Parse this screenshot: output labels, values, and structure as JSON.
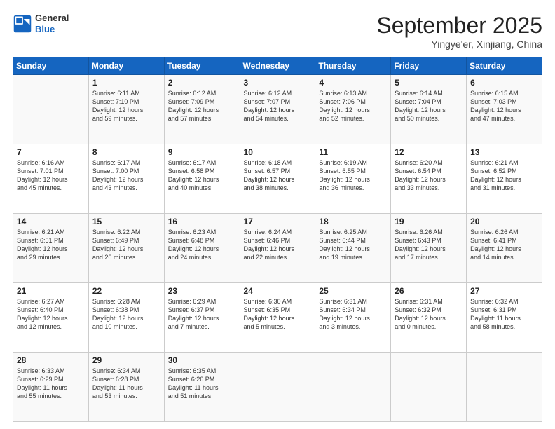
{
  "header": {
    "logo": {
      "general": "General",
      "blue": "Blue"
    },
    "title": "September 2025",
    "location": "Yingye'er, Xinjiang, China"
  },
  "days_of_week": [
    "Sunday",
    "Monday",
    "Tuesday",
    "Wednesday",
    "Thursday",
    "Friday",
    "Saturday"
  ],
  "weeks": [
    [
      {
        "day": "",
        "info": ""
      },
      {
        "day": "1",
        "info": "Sunrise: 6:11 AM\nSunset: 7:10 PM\nDaylight: 12 hours\nand 59 minutes."
      },
      {
        "day": "2",
        "info": "Sunrise: 6:12 AM\nSunset: 7:09 PM\nDaylight: 12 hours\nand 57 minutes."
      },
      {
        "day": "3",
        "info": "Sunrise: 6:12 AM\nSunset: 7:07 PM\nDaylight: 12 hours\nand 54 minutes."
      },
      {
        "day": "4",
        "info": "Sunrise: 6:13 AM\nSunset: 7:06 PM\nDaylight: 12 hours\nand 52 minutes."
      },
      {
        "day": "5",
        "info": "Sunrise: 6:14 AM\nSunset: 7:04 PM\nDaylight: 12 hours\nand 50 minutes."
      },
      {
        "day": "6",
        "info": "Sunrise: 6:15 AM\nSunset: 7:03 PM\nDaylight: 12 hours\nand 47 minutes."
      }
    ],
    [
      {
        "day": "7",
        "info": "Sunrise: 6:16 AM\nSunset: 7:01 PM\nDaylight: 12 hours\nand 45 minutes."
      },
      {
        "day": "8",
        "info": "Sunrise: 6:17 AM\nSunset: 7:00 PM\nDaylight: 12 hours\nand 43 minutes."
      },
      {
        "day": "9",
        "info": "Sunrise: 6:17 AM\nSunset: 6:58 PM\nDaylight: 12 hours\nand 40 minutes."
      },
      {
        "day": "10",
        "info": "Sunrise: 6:18 AM\nSunset: 6:57 PM\nDaylight: 12 hours\nand 38 minutes."
      },
      {
        "day": "11",
        "info": "Sunrise: 6:19 AM\nSunset: 6:55 PM\nDaylight: 12 hours\nand 36 minutes."
      },
      {
        "day": "12",
        "info": "Sunrise: 6:20 AM\nSunset: 6:54 PM\nDaylight: 12 hours\nand 33 minutes."
      },
      {
        "day": "13",
        "info": "Sunrise: 6:21 AM\nSunset: 6:52 PM\nDaylight: 12 hours\nand 31 minutes."
      }
    ],
    [
      {
        "day": "14",
        "info": "Sunrise: 6:21 AM\nSunset: 6:51 PM\nDaylight: 12 hours\nand 29 minutes."
      },
      {
        "day": "15",
        "info": "Sunrise: 6:22 AM\nSunset: 6:49 PM\nDaylight: 12 hours\nand 26 minutes."
      },
      {
        "day": "16",
        "info": "Sunrise: 6:23 AM\nSunset: 6:48 PM\nDaylight: 12 hours\nand 24 minutes."
      },
      {
        "day": "17",
        "info": "Sunrise: 6:24 AM\nSunset: 6:46 PM\nDaylight: 12 hours\nand 22 minutes."
      },
      {
        "day": "18",
        "info": "Sunrise: 6:25 AM\nSunset: 6:44 PM\nDaylight: 12 hours\nand 19 minutes."
      },
      {
        "day": "19",
        "info": "Sunrise: 6:26 AM\nSunset: 6:43 PM\nDaylight: 12 hours\nand 17 minutes."
      },
      {
        "day": "20",
        "info": "Sunrise: 6:26 AM\nSunset: 6:41 PM\nDaylight: 12 hours\nand 14 minutes."
      }
    ],
    [
      {
        "day": "21",
        "info": "Sunrise: 6:27 AM\nSunset: 6:40 PM\nDaylight: 12 hours\nand 12 minutes."
      },
      {
        "day": "22",
        "info": "Sunrise: 6:28 AM\nSunset: 6:38 PM\nDaylight: 12 hours\nand 10 minutes."
      },
      {
        "day": "23",
        "info": "Sunrise: 6:29 AM\nSunset: 6:37 PM\nDaylight: 12 hours\nand 7 minutes."
      },
      {
        "day": "24",
        "info": "Sunrise: 6:30 AM\nSunset: 6:35 PM\nDaylight: 12 hours\nand 5 minutes."
      },
      {
        "day": "25",
        "info": "Sunrise: 6:31 AM\nSunset: 6:34 PM\nDaylight: 12 hours\nand 3 minutes."
      },
      {
        "day": "26",
        "info": "Sunrise: 6:31 AM\nSunset: 6:32 PM\nDaylight: 12 hours\nand 0 minutes."
      },
      {
        "day": "27",
        "info": "Sunrise: 6:32 AM\nSunset: 6:31 PM\nDaylight: 11 hours\nand 58 minutes."
      }
    ],
    [
      {
        "day": "28",
        "info": "Sunrise: 6:33 AM\nSunset: 6:29 PM\nDaylight: 11 hours\nand 55 minutes."
      },
      {
        "day": "29",
        "info": "Sunrise: 6:34 AM\nSunset: 6:28 PM\nDaylight: 11 hours\nand 53 minutes."
      },
      {
        "day": "30",
        "info": "Sunrise: 6:35 AM\nSunset: 6:26 PM\nDaylight: 11 hours\nand 51 minutes."
      },
      {
        "day": "",
        "info": ""
      },
      {
        "day": "",
        "info": ""
      },
      {
        "day": "",
        "info": ""
      },
      {
        "day": "",
        "info": ""
      }
    ]
  ]
}
